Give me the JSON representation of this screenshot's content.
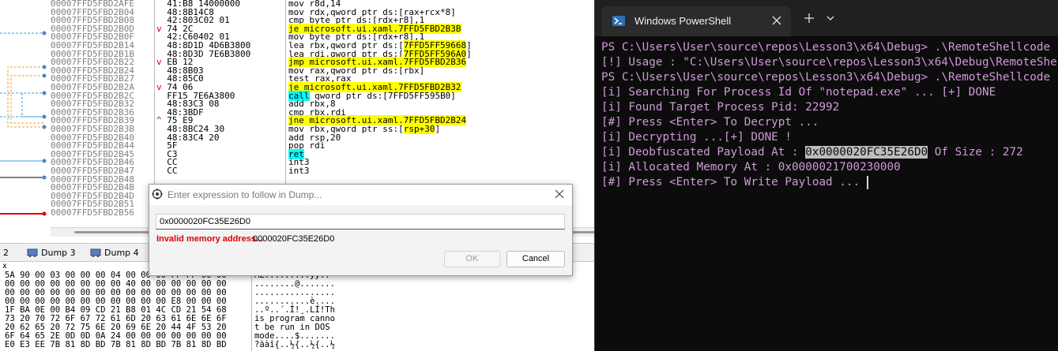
{
  "disassembly": {
    "addresses": [
      {
        "text": "00007FFD5FBD2AFE"
      },
      {
        "text": "00007FFD5FBD2B04"
      },
      {
        "text": "00007FFD5FBD2B08"
      },
      {
        "text": "00007FFD5FBD2B0D"
      },
      {
        "text": "00007FFD5FBD2B0F"
      },
      {
        "text": "00007FFD5FBD2B14"
      },
      {
        "text": "00007FFD5FBD2B1B"
      },
      {
        "text": "00007FFD5FBD2B22"
      },
      {
        "text": "00007FFD5FBD2B24"
      },
      {
        "text": "00007FFD5FBD2B27"
      },
      {
        "text": "00007FFD5FBD2B2A"
      },
      {
        "text": "00007FFD5FBD2B2C"
      },
      {
        "text": "00007FFD5FBD2B32"
      },
      {
        "text": "00007FFD5FBD2B36"
      },
      {
        "text": "00007FFD5FBD2B39"
      },
      {
        "text": "00007FFD5FBD2B3B"
      },
      {
        "text": "00007FFD5FBD2B40"
      },
      {
        "text": "00007FFD5FBD2B44"
      },
      {
        "text": "00007FFD5FBD2B45"
      },
      {
        "text": "00007FFD5FBD2B46"
      },
      {
        "text": "00007FFD5FBD2B47"
      },
      {
        "text": "00007FFD5FBD2B48"
      },
      {
        "text": "00007FFD5FBD2B4B"
      },
      {
        "text": "00007FFD5FBD2B4D"
      },
      {
        "text": "00007FFD5FBD2B51"
      },
      {
        "text": "00007FFD5FBD2B56"
      }
    ],
    "bytes": [
      "41:B8 14000000",
      "48:8B14C8",
      "42:803C02 01",
      "74 2C",
      "42:C60402 01",
      "48:8D1D 4D6B3800",
      "48:8D3D 7E6B3800",
      "EB 12",
      "48:8B03",
      "48:85C0",
      "74 06",
      "FF15 7E6A3800",
      "48:83C3 08",
      "48:3BDF",
      "75 E9",
      "48:8BC24 30",
      "48:83C4 20",
      "5F",
      "C3",
      "CC",
      "CC",
      "",
      "",
      "",
      "",
      ""
    ],
    "jump_marks": [
      "",
      "",
      "",
      "v",
      "",
      "",
      "",
      "v",
      "",
      "",
      "v",
      "",
      "",
      "",
      "^",
      "",
      "",
      "",
      "",
      "",
      "",
      "",
      "",
      "",
      "",
      ""
    ],
    "instructions": [
      {
        "pre": "mov r8d,14",
        "hl": "",
        "post": ""
      },
      {
        "pre": "mov rdx,qword ptr ds:[rax+rcx*8]",
        "hl": "",
        "post": ""
      },
      {
        "pre": "cmp byte ptr ds:[rdx+r8],1",
        "hl": "",
        "post": ""
      },
      {
        "pre": "",
        "hl": "je microsoft.ui.xaml.7FFD5FBD2B3B",
        "post": ""
      },
      {
        "pre": "mov byte ptr ds:[rdx+r8],1",
        "hl": "",
        "post": ""
      },
      {
        "pre": "lea rbx,qword ptr ds:[",
        "hl": "7FFD5FF59668",
        "post": "]"
      },
      {
        "pre": "lea rdi,qword ptr ds:[",
        "hl": "7FFD5FF596A0",
        "post": "]"
      },
      {
        "pre": "",
        "hl": "jmp microsoft.ui.xaml.7FFD5FBD2B36",
        "post": ""
      },
      {
        "pre": "mov rax,qword ptr ds:[rbx]",
        "hl": "",
        "post": ""
      },
      {
        "pre": "test rax,rax",
        "hl": "",
        "post": ""
      },
      {
        "pre": "",
        "hl": "je microsoft.ui.xaml.7FFD5FBD2B32",
        "post": ""
      },
      {
        "pre": "",
        "hl": "call",
        "post": " qword ptr ds:[7FFD5FF595B0]"
      },
      {
        "pre": "add rbx,8",
        "hl": "",
        "post": ""
      },
      {
        "pre": "cmp rbx,rdi",
        "hl": "",
        "post": ""
      },
      {
        "pre": "",
        "hl": "jne microsoft.ui.xaml.7FFD5FBD2B24",
        "post": ""
      },
      {
        "pre": "mov rbx,qword ptr ss:[",
        "hl": "rsp+30",
        "post": "]"
      },
      {
        "pre": "add rsp,20",
        "hl": "",
        "post": ""
      },
      {
        "pre": "pop rdi",
        "hl": "",
        "post": ""
      },
      {
        "pre": "",
        "hl": "ret",
        "post": ""
      },
      {
        "pre": "int3",
        "hl": "",
        "post": ""
      },
      {
        "pre": "int3",
        "hl": "",
        "post": ""
      },
      {
        "pre": "",
        "hl": "",
        "post": ""
      },
      {
        "pre": "",
        "hl": "",
        "post": ""
      },
      {
        "pre": "",
        "hl": "",
        "post": ""
      },
      {
        "pre": "",
        "hl": "",
        "post": ""
      },
      {
        "pre": "",
        "hl": "",
        "post": ""
      }
    ]
  },
  "dump_tabs": {
    "tab_partial": "2",
    "tab3": "Dump 3",
    "tab4": "Dump 4"
  },
  "dump_header": "x",
  "dump": {
    "rows": [
      {
        "hex": "5A 90 00 03 00 00 00 04 00 00 00 FF FF 00 00",
        "ascii": "MZ.........ÿÿ.."
      },
      {
        "hex": "00 00 00 00 00 00 00 00 40 00 00 00 00 00 00",
        "ascii": "........@......."
      },
      {
        "hex": "00 00 00 00 00 00 00 00 00 00 00 00 00 00 00",
        "ascii": "................"
      },
      {
        "hex": "00 00 00 00 00 00 00 00 00 00 00 E8 00 00 00",
        "ascii": "...........è...."
      },
      {
        "hex": "1F BA 0E 00 B4 09 CD 21 B8 01 4C CD 21 54 68",
        "ascii": "..º..´.Í!¸.LÍ!Th"
      },
      {
        "hex": "73 20 70 72 6F 67 72 61 6D 20 63 61 6E 6E 6F",
        "ascii": "is program canno"
      },
      {
        "hex": "20 62 65 20 72 75 6E 20 69 6E 20 44 4F 53 20",
        "ascii": "t be run in DOS "
      },
      {
        "hex": "6F 64 65 2E 0D 0D 0A 24 00 00 00 00 00 00 00",
        "ascii": "mode....$......."
      },
      {
        "hex": "E0 E3 EE 7B 81 8D BD 7B 81 8D BD 7B 81 8D BD",
        "ascii": "?ààî{..½{..½{..½"
      }
    ]
  },
  "dialog": {
    "title": "Enter expression to follow in Dump...",
    "input_value": "0x0000020FC35E26D0",
    "error_label": "Invalid memory address...",
    "error_value": "0000020FC35E26D0",
    "ok_label": "OK",
    "cancel_label": "Cancel"
  },
  "powershell": {
    "tab_title": "Windows PowerShell",
    "lines": [
      {
        "pre": "PS C:\\Users\\User\\source\\repos\\Lesson3\\x64\\Debug> .\\RemoteShellcode",
        "sel": "",
        "post": ""
      },
      {
        "pre": "[!] Usage : \"C:\\Users\\User\\source\\repos\\Lesson3\\x64\\Debug\\RemoteShel",
        "sel": "",
        "post": ""
      },
      {
        "pre": "PS C:\\Users\\User\\source\\repos\\Lesson3\\x64\\Debug> .\\RemoteShellcode",
        "sel": "",
        "post": ""
      },
      {
        "pre": "[i] Searching For Process Id Of \"notepad.exe\" ... [+] DONE",
        "sel": "",
        "post": ""
      },
      {
        "pre": "[i] Found Target Process Pid: 22992",
        "sel": "",
        "post": ""
      },
      {
        "pre": "[#] Press <Enter> To Decrypt ...",
        "sel": "",
        "post": ""
      },
      {
        "pre": "[i] Decrypting ...[+] DONE !",
        "sel": "",
        "post": ""
      },
      {
        "pre": "[i] Deobfuscated Payload At : ",
        "sel": "0x0000020FC35E26D0",
        "post": " Of Size : 272"
      },
      {
        "pre": "[i] Allocated Memory At : 0x0000021700230000",
        "sel": "",
        "post": ""
      },
      {
        "pre": "[#] Press <Enter> To Write Payload ... ",
        "sel": "",
        "post": ""
      }
    ]
  },
  "colors": {
    "console_text": "#cf9ad8",
    "console_bg": "#0c0c0c",
    "highlight_yellow": "#ffff00",
    "highlight_cyan": "#00ffff",
    "error_red": "#e00000",
    "breakpoint_red": "#e00000"
  },
  "icons": [
    "powershell-icon",
    "close-icon",
    "plus-icon",
    "chevron-down-icon",
    "dump-tab-icon",
    "target-icon"
  ]
}
